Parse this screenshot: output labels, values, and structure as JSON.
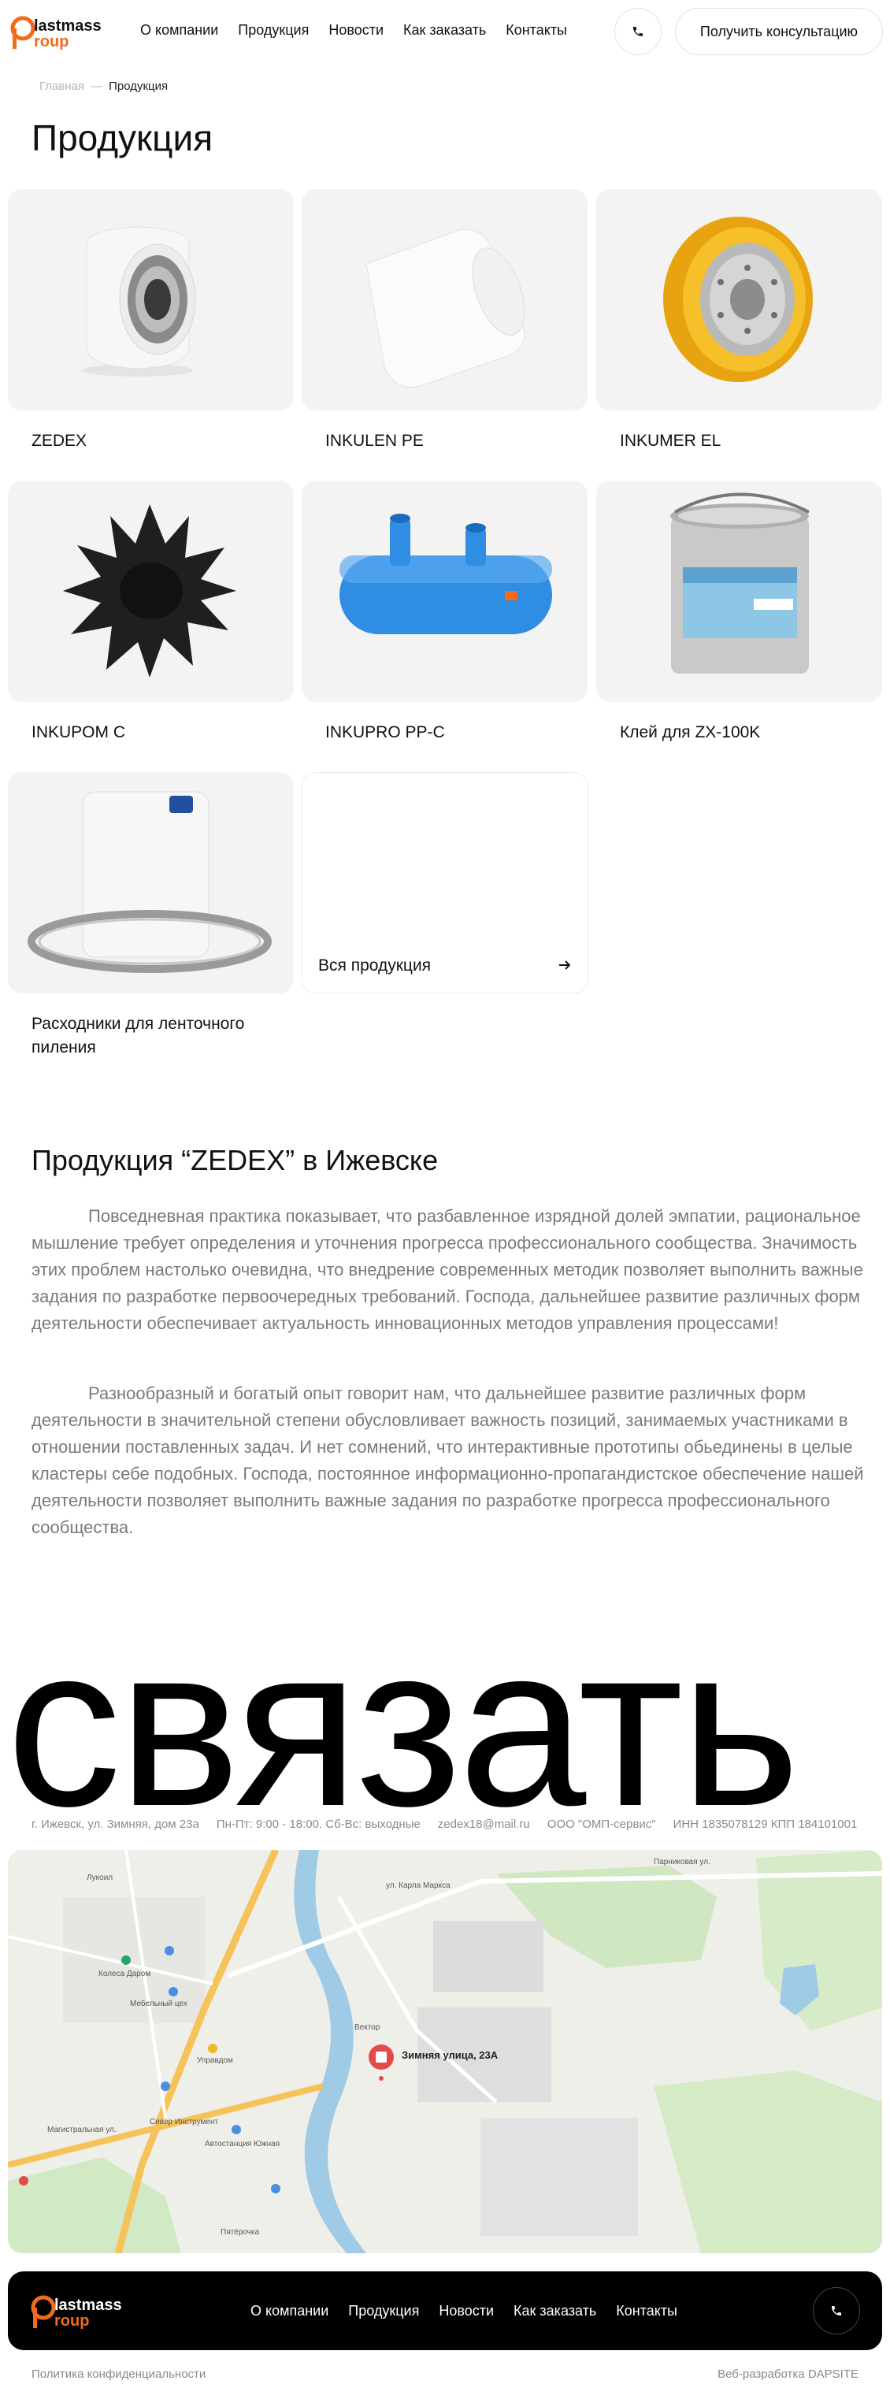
{
  "header": {
    "logo_text_top": "lastmass",
    "logo_text_bottom": "roup",
    "nav": [
      "О компании",
      "Продукция",
      "Новости",
      "Как заказать",
      "Контакты"
    ],
    "consult_label": "Получить консультацию"
  },
  "breadcrumb": {
    "home": "Главная",
    "separator": "—",
    "current": "Продукция"
  },
  "page_title": "Продукция",
  "products": [
    {
      "name": "ZEDEX"
    },
    {
      "name": "INKULEN PE"
    },
    {
      "name": "INKUMER EL"
    },
    {
      "name": "INKUPOM C"
    },
    {
      "name": "INKUPRO PP-C"
    },
    {
      "name": "Клей для ZX-100K"
    },
    {
      "name": "Расходники для ленточного пиления"
    }
  ],
  "all_products_label": "Вся продукция",
  "description": {
    "title": "Продукция “ZEDEX” в Ижевске",
    "p1": "Повседневная практика показывает, что разбавленное изрядной долей эмпатии, рациональное мышление требует определения и уточнения прогресса профессионального сообщества. Значимость этих проблем настолько очевидна, что внедрение современных методик позволяет выполнить важные задания по разработке первоочередных требований. Господа, дальнейшее развитие различных форм деятельности обеспечивает актуальность инновационных методов управления процессами!",
    "p2": "Разнообразный и богатый опыт говорит нам, что дальнейшее развитие различных форм деятельности в значительной степени обусловливает важность позиций, занимаемых участниками в отношении поставленных задач. И нет сомнений, что интерактивные прототипы обьединены в целые кластеры себе подобных. Господа, постоянное информационно-пропагандистское обеспечение нашей деятельности позволяет выполнить важные задания по разработке прогресса профессионального сообщества."
  },
  "big_word": "связать",
  "contacts": {
    "address": "г. Ижевск, ул. Зимняя, дом 23а",
    "hours": "Пн-Пт: 9:00 - 18:00. Сб-Вс: выходные",
    "email": "zedex18@mail.ru",
    "company": "ООО \"ОМП-сервис\"",
    "requisites": "ИНН 1835078129 КПП 184101001"
  },
  "map": {
    "pin_label": "Зимняя улица, 23А",
    "labels": [
      "Колеса Даром",
      "Мебельный цех",
      "Управдом",
      "Лукоил",
      "Вектор",
      "Север Инструмент",
      "Автостанция Южная",
      "Пятёрочка",
      "Магистральная ул.",
      "ул. Карла Маркса",
      "Парниковая ул."
    ]
  },
  "footer": {
    "nav": [
      "О компании",
      "Продукция",
      "Новости",
      "Как заказать",
      "Контакты"
    ],
    "privacy": "Политика конфиденциальности",
    "developer": "Веб-разработка DAPSITE"
  },
  "colors": {
    "accent": "#f26a1b",
    "card_bg": "#f3f3f3",
    "text_muted": "#7a7a7a"
  }
}
